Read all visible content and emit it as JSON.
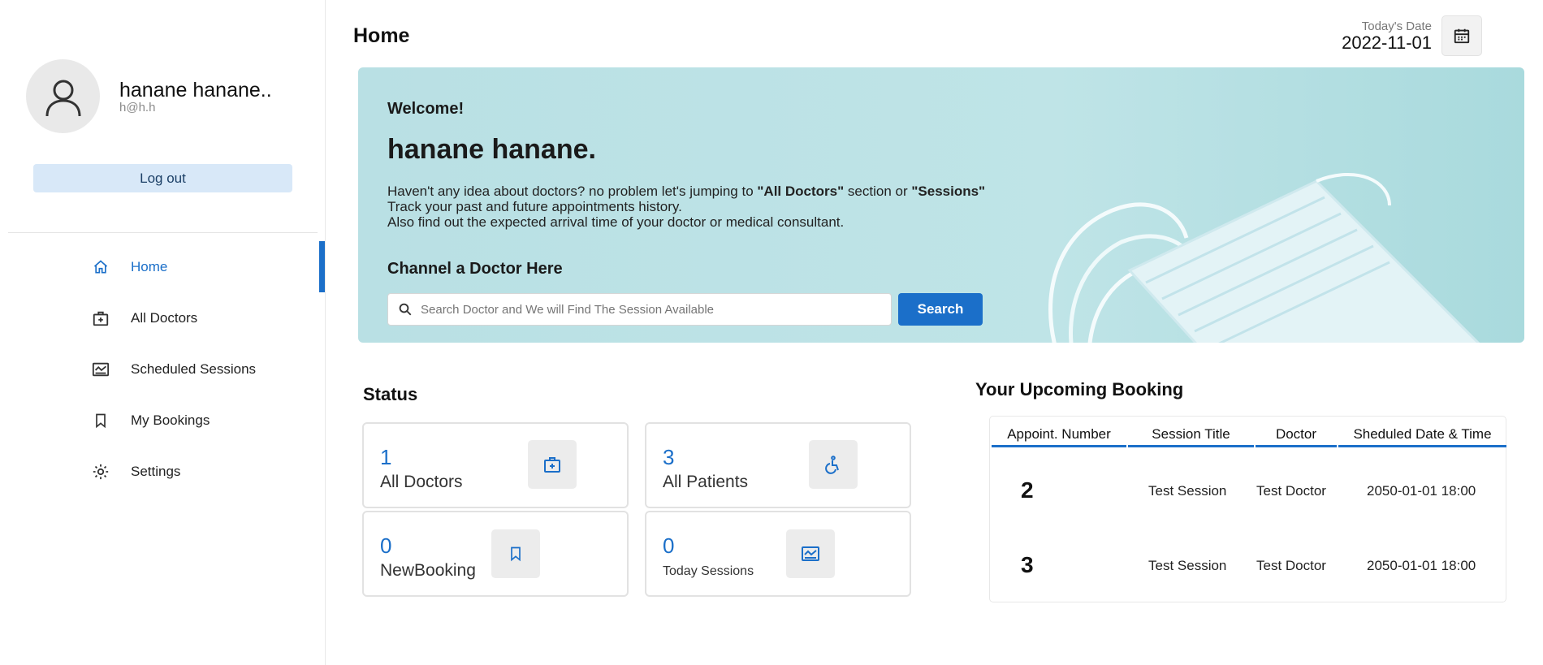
{
  "profile": {
    "name": "hanane hanane..",
    "email": "h@h.h",
    "logout_label": "Log out"
  },
  "nav": [
    {
      "label": "Home",
      "icon": "home-icon",
      "active": true
    },
    {
      "label": "All Doctors",
      "icon": "doctor-bag-icon"
    },
    {
      "label": "Scheduled Sessions",
      "icon": "schedule-icon"
    },
    {
      "label": "My Bookings",
      "icon": "bookmark-icon"
    },
    {
      "label": "Settings",
      "icon": "gear-icon"
    }
  ],
  "header": {
    "title": "Home",
    "date_label": "Today's Date",
    "date_value": "2022-11-01",
    "calendar_icon": "calendar-icon"
  },
  "banner": {
    "welcome": "Welcome!",
    "name": "hanane hanane.",
    "line1_pre": "Haven't any idea about doctors? no problem let's jumping to ",
    "line1_bold1": "\"All Doctors\"",
    "line1_mid": " section or ",
    "line1_bold2": "\"Sessions\"",
    "line2": "Track your past and future appointments history.",
    "line3": "Also find out the expected arrival time of your doctor or medical consultant.",
    "channel_title": "Channel a Doctor Here",
    "search_placeholder": "Search Doctor and We will Find The Session Available",
    "search_button": "Search"
  },
  "status": {
    "title": "Status",
    "cards": [
      {
        "value": "1",
        "label": "All Doctors",
        "icon": "doctor-bag-icon"
      },
      {
        "value": "3",
        "label": "All Patients",
        "icon": "wheelchair-icon"
      },
      {
        "value": "0",
        "label": "NewBooking",
        "icon": "bookmark-icon"
      },
      {
        "value": "0",
        "label": "Today Sessions",
        "icon": "schedule-icon"
      }
    ]
  },
  "bookings": {
    "title": "Your Upcoming Booking",
    "columns": [
      "Appoint. Number",
      "Session Title",
      "Doctor",
      "Sheduled Date & Time"
    ],
    "rows": [
      {
        "number": "2",
        "session": "Test Session",
        "doctor": "Test Doctor",
        "datetime": "2050-01-01 18:00"
      },
      {
        "number": "3",
        "session": "Test Session",
        "doctor": "Test Doctor",
        "datetime": "2050-01-01 18:00"
      }
    ]
  },
  "colors": {
    "accent": "#1b6fc9",
    "banner_bg": "#bfe4e7",
    "logout_bg": "#d8e8f8"
  }
}
